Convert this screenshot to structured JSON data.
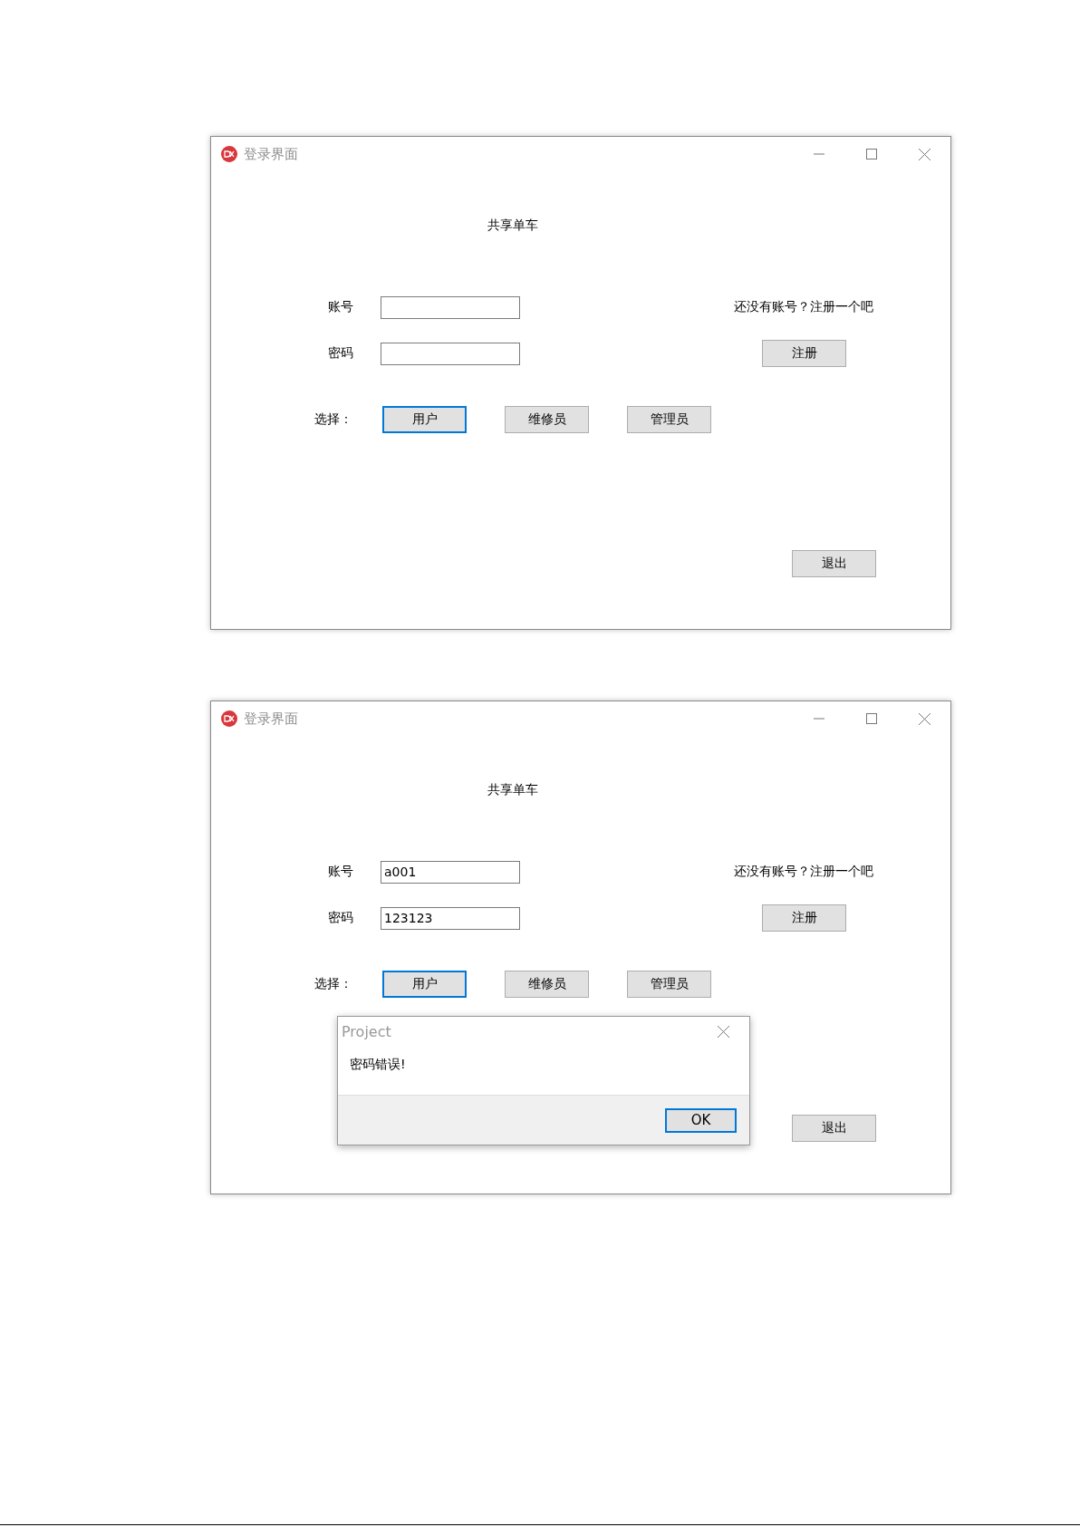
{
  "windows": [
    {
      "title": "登录界面",
      "heading": "共享单车",
      "fields": [
        {
          "label": "账号"
        },
        {
          "label": "密码"
        }
      ],
      "register_prompt": "还没有账号？注册一个吧",
      "register_button": "注册",
      "role_label": "选择：",
      "roles": [
        {
          "label": "用户",
          "selected": true
        },
        {
          "label": "维修员",
          "selected": false
        },
        {
          "label": "管理员",
          "selected": false
        }
      ],
      "exit_button": "退出"
    },
    {
      "title": "登录界面",
      "heading": "共享单车",
      "fields": [
        {
          "label": "账号",
          "value": "a001"
        },
        {
          "label": "密码",
          "value": "123123"
        }
      ],
      "register_prompt": "还没有账号？注册一个吧",
      "register_button": "注册",
      "role_label": "选择：",
      "roles": [
        {
          "label": "用户",
          "selected": true
        },
        {
          "label": "维修员",
          "selected": false
        },
        {
          "label": "管理员",
          "selected": false
        }
      ],
      "exit_button": "退出",
      "dialog": {
        "title": "Project",
        "message": "密码错误!",
        "button": "OK"
      }
    }
  ]
}
